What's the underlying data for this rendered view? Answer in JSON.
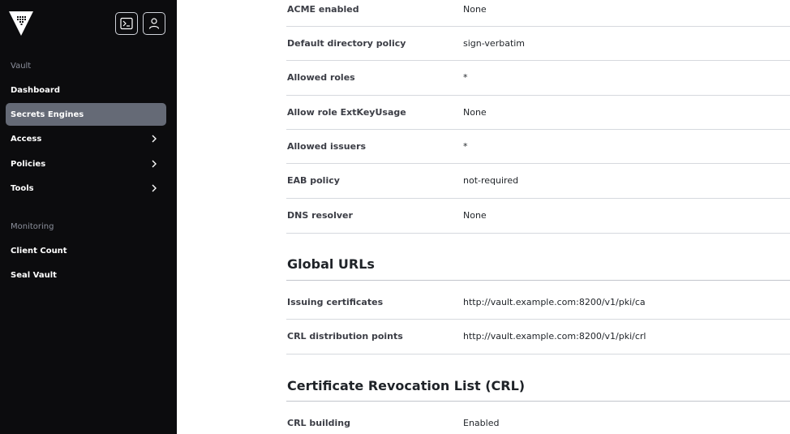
{
  "sidebar": {
    "sections": [
      {
        "heading": "Vault"
      },
      {
        "heading": "Monitoring"
      }
    ],
    "items": [
      {
        "label": "Dashboard"
      },
      {
        "label": "Secrets Engines"
      },
      {
        "label": "Access"
      },
      {
        "label": "Policies"
      },
      {
        "label": "Tools"
      },
      {
        "label": "Client Count"
      },
      {
        "label": "Seal Vault"
      }
    ]
  },
  "acme_rows": [
    {
      "label": "ACME enabled",
      "value": "None"
    },
    {
      "label": "Default directory policy",
      "value": "sign-verbatim"
    },
    {
      "label": "Allowed roles",
      "value": "*"
    },
    {
      "label": "Allow role ExtKeyUsage",
      "value": "None"
    },
    {
      "label": "Allowed issuers",
      "value": "*"
    },
    {
      "label": "EAB policy",
      "value": "not-required"
    },
    {
      "label": "DNS resolver",
      "value": "None"
    }
  ],
  "global_urls": {
    "title": "Global URLs",
    "rows": [
      {
        "label": "Issuing certificates",
        "value": "http://vault.example.com:8200/v1/pki/ca"
      },
      {
        "label": "CRL distribution points",
        "value": "http://vault.example.com:8200/v1/pki/crl"
      }
    ]
  },
  "crl": {
    "title": "Certificate Revocation List (CRL)",
    "rows": [
      {
        "label": "CRL building",
        "value": "Enabled"
      }
    ]
  }
}
